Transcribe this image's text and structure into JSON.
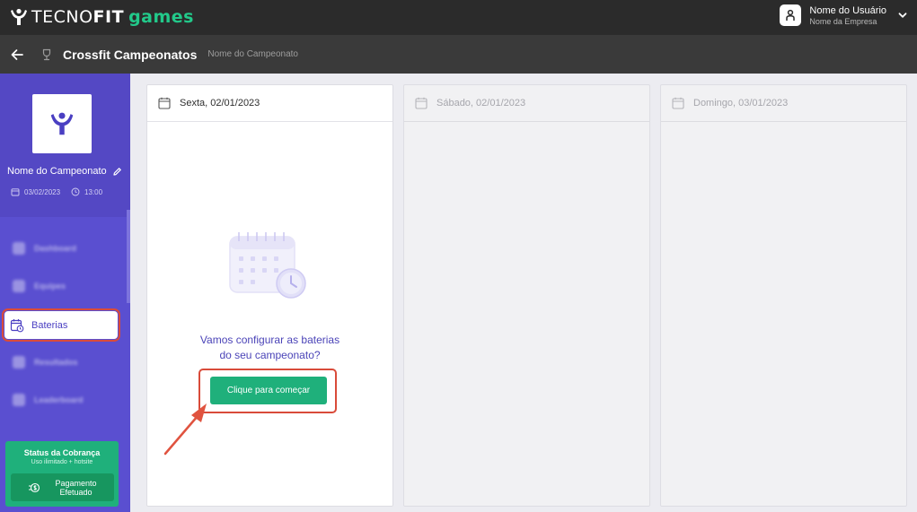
{
  "app": {
    "logo_text_1": "TECNO",
    "logo_text_2": "FIT",
    "logo_text_3": "games",
    "brand_color": "#22c98a"
  },
  "user": {
    "name": "Nome do Usuário",
    "company": "Nome da Empresa"
  },
  "breadcrumb": {
    "title": "Crossfit Campeonatos",
    "subtitle": "Nome do Campeonato"
  },
  "sidebar": {
    "champ_name": "Nome do Campeonato",
    "date": "03/02/2023",
    "time": "13:00",
    "blurred_items": [
      {
        "label": "Dashboard"
      },
      {
        "label": "Equipes"
      }
    ],
    "active_item": {
      "label": "Baterias"
    },
    "blurred_items_after": [
      {
        "label": "Resultados"
      },
      {
        "label": "Leaderboard"
      }
    ],
    "billing": {
      "title": "Status da Cobrança",
      "subtitle": "Uso ilimitado + hotsite",
      "button_label_1": "Pagamento",
      "button_label_2": "Efetuado"
    }
  },
  "columns": [
    {
      "date_label": "Sexta, 02/01/2023"
    },
    {
      "date_label": "Sábado, 02/01/2023"
    },
    {
      "date_label": "Domingo, 03/01/2023"
    }
  ],
  "empty_state": {
    "message_line_1": "Vamos configurar as baterias",
    "message_line_2": "do seu campeonato?",
    "button_label": "Clique para começar"
  },
  "colors": {
    "topbar": "#2b2b2b",
    "sidebar": "#5a4fd0",
    "highlight": "#d94b3a",
    "primary_button": "#1fb07b"
  }
}
